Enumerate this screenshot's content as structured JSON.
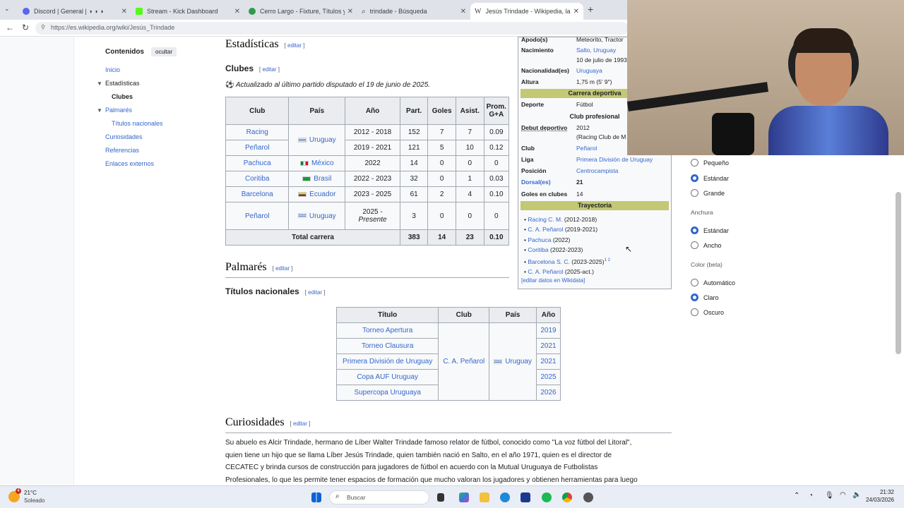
{
  "browser": {
    "tabs": [
      {
        "title": "Discord | General | ◑ ◑ ◑"
      },
      {
        "title": "Stream - Kick Dashboard"
      },
      {
        "title": "Cerro Largo - Fixture, Títulos y Pla"
      },
      {
        "title": "trindade - Búsqueda"
      },
      {
        "title": "Jesús Trindade - Wikipedia, la enci"
      }
    ],
    "url": "https://es.wikipedia.org/wiki/Jesús_Trindade",
    "new_tab": "+"
  },
  "toc": {
    "title": "Contenidos",
    "hide_label": "ocultar",
    "items": [
      "Inicio",
      "Estadísticas",
      "Clubes",
      "Palmarés",
      "Títulos nacionales",
      "Curiosidades",
      "Referencias",
      "Enlaces externos"
    ]
  },
  "edit": "editar",
  "sections": {
    "estadisticas": "Estadísticas",
    "clubes": "Clubes",
    "updated": "Actualizado al último partido disputado el 19 de junio de 2025.",
    "palmares": "Palmarés",
    "titulos": "Títulos nacionales",
    "curiosidades": "Curiosidades"
  },
  "clubs_table": {
    "headers": [
      "Club",
      "País",
      "Año",
      "Part.",
      "Goles",
      "Asist.",
      "Prom. G+A"
    ],
    "rows": [
      {
        "club": "Racing",
        "pais": "Uruguay",
        "ano": "2012 - 2018",
        "part": "152",
        "goles": "7",
        "asist": "7",
        "prom": "0.09"
      },
      {
        "club": "Peñarol",
        "ano": "2019 - 2021",
        "part": "121",
        "goles": "5",
        "asist": "10",
        "prom": "0.12"
      },
      {
        "club": "Pachuca",
        "pais": "México",
        "ano": "2022",
        "part": "14",
        "goles": "0",
        "asist": "0",
        "prom": "0"
      },
      {
        "club": "Coritiba",
        "pais": "Brasil",
        "ano": "2022 - 2023",
        "part": "32",
        "goles": "0",
        "asist": "1",
        "prom": "0.03"
      },
      {
        "club": "Barcelona",
        "pais": "Ecuador",
        "ano": "2023 - 2025",
        "part": "61",
        "goles": "2",
        "asist": "4",
        "prom": "0.10"
      },
      {
        "club": "Peñarol",
        "pais": "Uruguay",
        "ano": "2025 -",
        "ano2": "Presente",
        "part": "3",
        "goles": "0",
        "asist": "0",
        "prom": "0"
      }
    ],
    "total_label": "Total carrera",
    "total": {
      "part": "383",
      "goles": "14",
      "asist": "23",
      "prom": "0.10"
    }
  },
  "titles_table": {
    "headers": [
      "Título",
      "Club",
      "País",
      "Año"
    ],
    "rows": [
      {
        "titulo": "Torneo Apertura",
        "ano": "2019"
      },
      {
        "titulo": "Torneo Clausura",
        "ano": "2021"
      },
      {
        "titulo": "Primera División de Uruguay",
        "ano": "2021"
      },
      {
        "titulo": "Copa AUF Uruguay",
        "ano": "2025"
      },
      {
        "titulo": "Supercopa Uruguaya",
        "ano": "2026"
      }
    ],
    "club": "C. A. Peñarol",
    "pais": "Uruguay"
  },
  "curiosidades_text": [
    "Su abuelo es Alcir Trindade, hermano de Líber Walter Trindade famoso relator de fútbol, conocido como \"La voz fútbol del Litoral\",",
    "quien tiene un hijo que se llama Líber Jesús Trindade, quien también nació en Salto, en el año 1971, quien es el director de",
    "CECATEC y brinda cursos de construcción para jugadores de fútbol en acuerdo con la Mutual Uruguaya de Futbolistas",
    "Profesionales, lo que les permite tener espacios de formación que mucho valoran los jugadores y obtienen herramientas para luego"
  ],
  "infobox": {
    "apodo_label": "Apodo(s)",
    "apodo_value": "Meteorito, Tractor",
    "nacimiento_label": "Nacimiento",
    "nacimiento_value": "Salto, Uruguay",
    "nacimiento_date": "10 de julio de 1993",
    "nacionalidad_label": "Nacionalidad(es)",
    "nacionalidad_value": "Uruguaya",
    "altura_label": "Altura",
    "altura_value": "1,75 m (5′ 9″)",
    "band_carrera": "Carrera deportiva",
    "deporte_label": "Deporte",
    "deporte_value": "Fútbol",
    "band_club": "Club profesional",
    "debut_label": "Debut deportivo",
    "debut_value": "2012",
    "debut_club": "(Racing Club de M",
    "club_label": "Club",
    "club_value": "Peñarol",
    "liga_label": "Liga",
    "liga_value": "Primera División de Uruguay",
    "posicion_label": "Posición",
    "posicion_value": "Centrocampista",
    "dorsal_label": "Dorsal(es)",
    "dorsal_value": "21",
    "goles_label": "Goles en clubes",
    "goles_value": "14",
    "band_trayectoria": "Trayectoria",
    "trayectoria": [
      {
        "club": "Racing C. M.",
        "years": "(2012-2018)"
      },
      {
        "club": "C. A. Peñarol",
        "years": "(2019-2021)"
      },
      {
        "club": "Pachuca",
        "years": "(2022)"
      },
      {
        "club": "Coritiba",
        "years": "(2022-2023)"
      },
      {
        "club": "Barcelona S. C.",
        "years": "(2023-2025)",
        "sup": "1 2"
      },
      {
        "club": "C. A. Peñarol",
        "years": "(2025-act.)"
      }
    ],
    "wikidata": "[editar datos en Wikidata]"
  },
  "appearance": {
    "text_options": [
      "Pequeño",
      "Estándar",
      "Grande"
    ],
    "width_label": "Anchura",
    "width_options": [
      "Estándar",
      "Ancho"
    ],
    "color_label": "Color (beta)",
    "color_options": [
      "Automático",
      "Claro",
      "Oscuro"
    ]
  },
  "taskbar": {
    "weather_temp": "21°C",
    "weather_desc": "Soleado",
    "weather_badge": "4",
    "search_placeholder": "Buscar",
    "time": "21:32",
    "date": "24/03/2026"
  }
}
